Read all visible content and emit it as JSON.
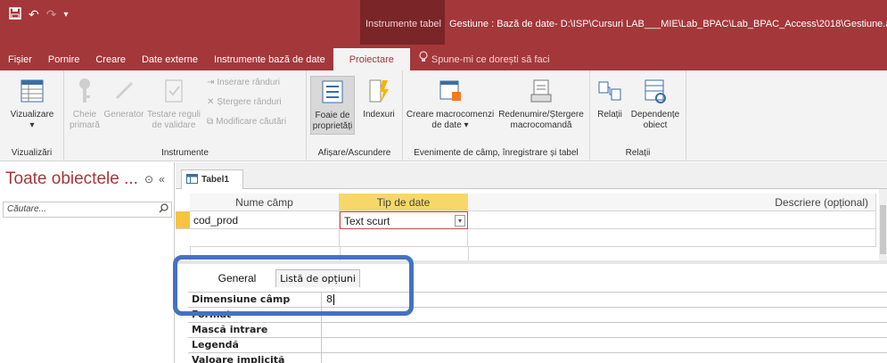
{
  "titlebar": {
    "context_tab": "Instrumente tabel",
    "document_title": "Gestiune : Bază de date- D:\\ISP\\Cursuri LAB___MIE\\Lab_BPAC\\Lab_BPAC_Access\\2018\\Gestiune.accdb (Fo"
  },
  "tabs": [
    {
      "label": "Fișier"
    },
    {
      "label": "Pornire"
    },
    {
      "label": "Creare"
    },
    {
      "label": "Date externe"
    },
    {
      "label": "Instrumente bază de date"
    },
    {
      "label": "Proiectare"
    }
  ],
  "tell_me": "Spune-mi ce dorești să faci",
  "ribbon": {
    "groups": {
      "vizualizari": "Vizualizări",
      "instrumente": "Instrumente",
      "afisare": "Afișare/Ascundere",
      "evenimente": "Evenimente de câmp, înregistrare și tabel",
      "relatii": "Relații"
    },
    "buttons": {
      "vizualizare_l1": "Vizualizare",
      "vizualizare_l2": "▾",
      "cheie_l1": "Cheie",
      "cheie_l2": "primară",
      "generator": "Generator",
      "testare_l1": "Testare reguli",
      "testare_l2": "de validare",
      "inserare": "Inserare rânduri",
      "stergere": "Ștergere rânduri",
      "modificare": "Modificare căutări",
      "foaie_l1": "Foaie de",
      "foaie_l2": "proprietăți",
      "indexuri": "Indexuri",
      "creare_l1": "Creare macrocomenzi",
      "creare_l2": "de date ▾",
      "redenumire_l1": "Redenumire/Ștergere",
      "redenumire_l2": "macrocomandă",
      "relatii": "Relații",
      "dependente_l1": "Dependențe",
      "dependente_l2": "obiect"
    }
  },
  "nav": {
    "title": "Toate obiectele ...",
    "search_placeholder": "Căutare..."
  },
  "document_tab": "Tabel1",
  "design": {
    "headers": {
      "field_name": "Nume câmp",
      "data_type": "Tip de date",
      "description": "Descriere (opțional)"
    },
    "row": {
      "field_name": "cod_prod",
      "data_type": "Text scurt"
    }
  },
  "properties": {
    "tabs": {
      "general": "General",
      "lookup": "Listă de opțiuni"
    },
    "rows": [
      {
        "label": "Dimensiune câmp",
        "value": "8"
      },
      {
        "label": "Format",
        "value": ""
      },
      {
        "label": "Mască intrare",
        "value": ""
      },
      {
        "label": "Legendă",
        "value": ""
      },
      {
        "label": "Valoare implicită",
        "value": ""
      }
    ]
  },
  "colors": {
    "accent": "#a4373a",
    "highlight_box": "#4472c4",
    "data_type_header": "#f8d76a"
  }
}
